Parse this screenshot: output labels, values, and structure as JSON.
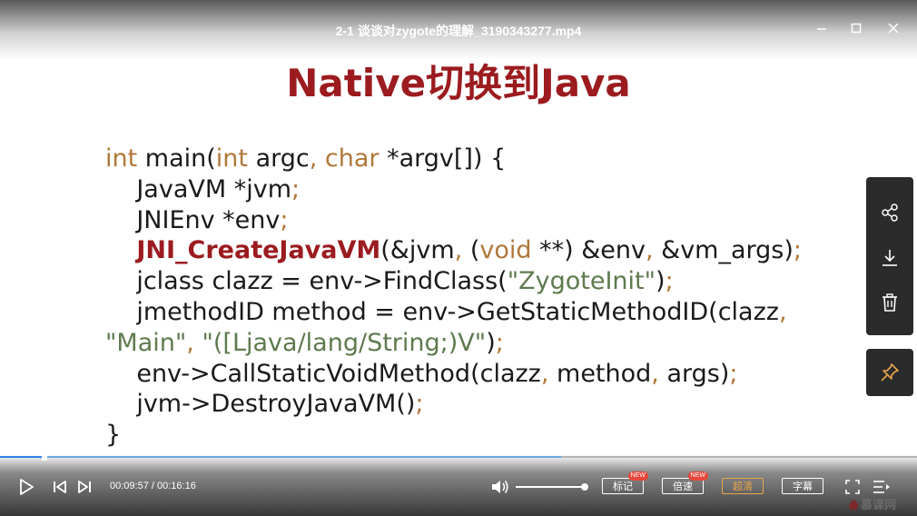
{
  "window": {
    "title": "2-1 谈谈对zygote的理解_3190343277.mp4",
    "minimize_icon": "minimize-icon",
    "maximize_icon": "maximize-icon",
    "close_icon": "close-icon"
  },
  "slide": {
    "title": "Native切换到Java",
    "code_lines": [
      [
        {
          "t": "int",
          "c": "kw"
        },
        {
          "t": " main("
        },
        {
          "t": "int",
          "c": "kw"
        },
        {
          "t": " argc"
        },
        {
          "t": ",",
          "c": "pun"
        },
        {
          "t": " "
        },
        {
          "t": "char",
          "c": "kw"
        },
        {
          "t": " *argv[]) {"
        }
      ],
      [
        {
          "t": "    JavaVM *jvm"
        },
        {
          "t": ";",
          "c": "pun"
        }
      ],
      [
        {
          "t": "    JNIEnv *env"
        },
        {
          "t": ";",
          "c": "pun"
        }
      ],
      [
        {
          "t": "    "
        },
        {
          "t": "JNI_CreateJavaVM",
          "c": "fn"
        },
        {
          "t": "(&jvm"
        },
        {
          "t": ",",
          "c": "pun"
        },
        {
          "t": " ("
        },
        {
          "t": "void",
          "c": "kw"
        },
        {
          "t": " **) &env"
        },
        {
          "t": ",",
          "c": "pun"
        },
        {
          "t": " &vm_args)"
        },
        {
          "t": ";",
          "c": "pun"
        }
      ],
      [
        {
          "t": "    jclass clazz = env->FindClass("
        },
        {
          "t": "\"ZygoteInit\"",
          "c": "str"
        },
        {
          "t": ")"
        },
        {
          "t": ";",
          "c": "pun"
        }
      ],
      [
        {
          "t": "    jmethodID method = env->GetStaticMethodID(clazz"
        },
        {
          "t": ",",
          "c": "pun"
        }
      ],
      [
        {
          "t": "\"Main\"",
          "c": "str"
        },
        {
          "t": ",",
          "c": "pun"
        },
        {
          "t": " "
        },
        {
          "t": "\"([Ljava/lang/String;)V\"",
          "c": "str"
        },
        {
          "t": ")"
        },
        {
          "t": ";",
          "c": "pun"
        }
      ],
      [
        {
          "t": "    env->CallStaticVoidMethod(clazz"
        },
        {
          "t": ",",
          "c": "pun"
        },
        {
          "t": " method"
        },
        {
          "t": ",",
          "c": "pun"
        },
        {
          "t": " args)"
        },
        {
          "t": ";",
          "c": "pun"
        }
      ],
      [
        {
          "t": "    jvm->DestroyJavaVM()"
        },
        {
          "t": ";",
          "c": "pun"
        }
      ],
      [
        {
          "t": "}"
        }
      ]
    ]
  },
  "side_panel": {
    "share_icon": "share-icon",
    "download_icon": "download-icon",
    "delete_icon": "trash-icon",
    "pin_icon": "pin-icon"
  },
  "player": {
    "progress_fraction": 0.612,
    "buffered_fraction": 0.612,
    "current_time": "00:09:57",
    "duration": "00:16:16",
    "time_display": "00:09:57 / 00:16:16",
    "volume_fraction": 1.0,
    "buttons": {
      "bookmark": "标记",
      "speed": "倍速",
      "quality": "超清",
      "subtitle": "字幕"
    },
    "new_badge": "NEW",
    "logo_text": "慕课网",
    "accent_color": "#e8a64c",
    "progress_color": "#2f80e6"
  }
}
